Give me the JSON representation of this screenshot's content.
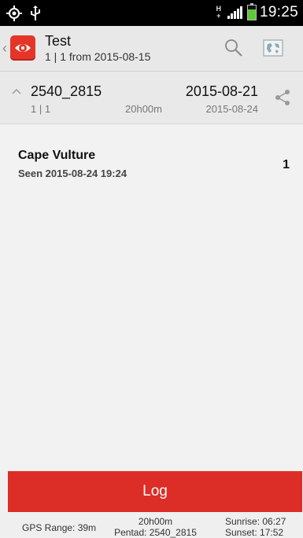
{
  "status_bar": {
    "clock": "19:25",
    "network": "H",
    "network_plus": "+",
    "battery_level": 0.7,
    "battery_color": "#5ec737",
    "icons": [
      "gps-icon",
      "usb-icon",
      "hplus-icon",
      "signal-icon",
      "battery-icon"
    ]
  },
  "action_bar": {
    "title": "Test",
    "subtitle": "1 | 1 from 2015-08-15",
    "icons": [
      "back-chevron-icon",
      "app-logo-icon",
      "search-icon",
      "map-icon"
    ]
  },
  "card": {
    "pentad": "2540_2815",
    "counts": "1 | 1",
    "duration": "20h00m",
    "start_date": "2015-08-21",
    "end_date": "2015-08-24",
    "icons": [
      "chevron-up-icon",
      "share-icon"
    ]
  },
  "records": [
    {
      "name": "Cape Vulture",
      "seen": "Seen 2015-08-24 19:24",
      "count": "1"
    }
  ],
  "log_button": {
    "label": "Log",
    "color": "#dc2d27"
  },
  "footer": {
    "gps_range": "GPS Range: 39m",
    "duration": "20h00m",
    "pentad": "Pentad: 2540_2815",
    "sunrise": "Sunrise: 06:27",
    "sunset": "Sunset: 17:52"
  },
  "colors": {
    "accent": "#e53528",
    "action_bar_bg": "#e8e8e8",
    "status_bar_bg": "#000000"
  }
}
